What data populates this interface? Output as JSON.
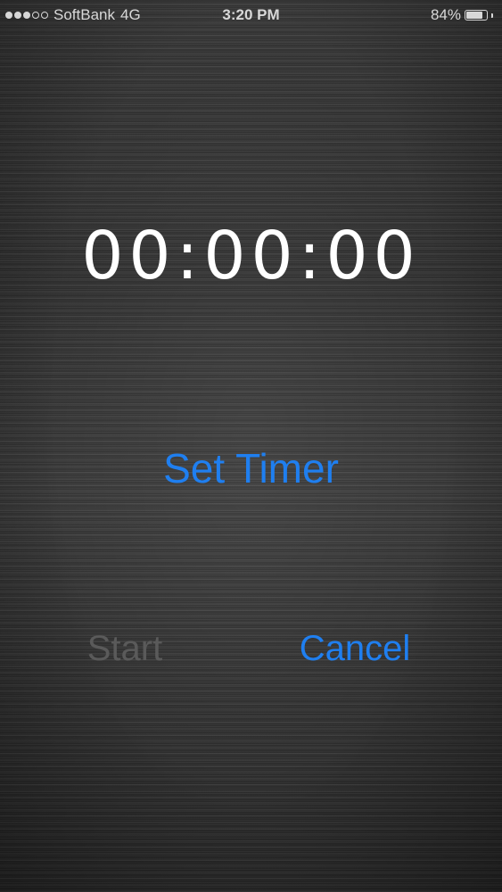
{
  "status_bar": {
    "carrier": "SoftBank",
    "network": "4G",
    "time": "3:20 PM",
    "battery_text": "84%",
    "battery_level": 0.84,
    "signal_bars_full": 3,
    "signal_bars_total": 5
  },
  "timer": {
    "display": "00:00:00"
  },
  "actions": {
    "set_timer_label": "Set Timer",
    "start_label": "Start",
    "cancel_label": "Cancel"
  },
  "colors": {
    "accent": "#1f7ff0",
    "disabled": "#5a5a5a",
    "text": "#ffffff"
  }
}
